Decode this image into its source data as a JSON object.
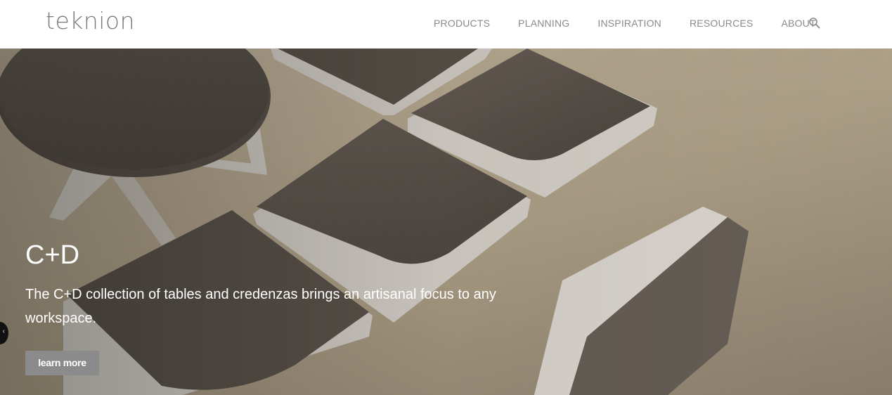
{
  "brand": {
    "logo_text": "teknion"
  },
  "nav": {
    "items": [
      {
        "label": "PRODUCTS"
      },
      {
        "label": "PLANNING"
      },
      {
        "label": "INSPIRATION"
      },
      {
        "label": "RESOURCES"
      },
      {
        "label": "ABOUT"
      }
    ],
    "search_icon": "search-icon"
  },
  "hero": {
    "title": "C+D",
    "description": "The C+D collection of tables and credenzas brings an artisanal focus to any workspace.",
    "cta_label": "learn more",
    "prev_arrow_icon": "chevron-left-icon"
  },
  "colors": {
    "nav_text": "#8a8a8a",
    "logo": "#7a7a7a",
    "cta_bg": "#8b8b8b",
    "hero_text": "#ffffff"
  }
}
